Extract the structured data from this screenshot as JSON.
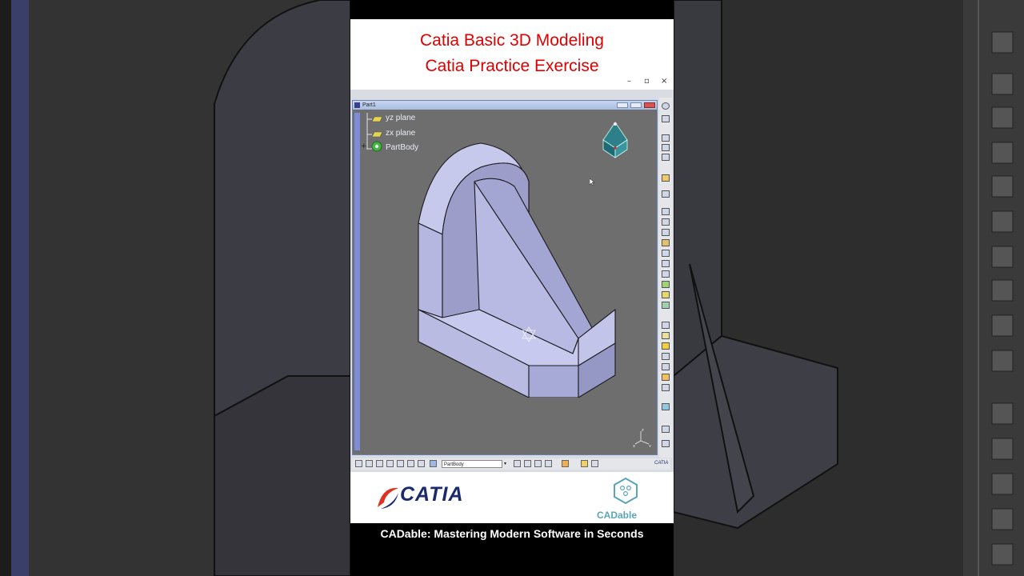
{
  "overlay": {
    "title_line1": "Catia Basic 3D Modeling",
    "title_line2": "Catia Practice Exercise",
    "caption": "CADable: Mastering Modern Software in Seconds"
  },
  "window_controls": {
    "minimize": "–",
    "restore": "▫",
    "close": "×"
  },
  "viewer": {
    "title": "Part1",
    "tree": [
      {
        "label": "yz plane",
        "icon": "plane-icon"
      },
      {
        "label": "zx plane",
        "icon": "plane-icon"
      },
      {
        "label": "PartBody",
        "icon": "partbody-gear-icon"
      }
    ],
    "axis_labels": {
      "z": "z",
      "x": "x",
      "y": "y"
    }
  },
  "toolbar": {
    "body_select": "PartBody",
    "brand": "CATIA"
  },
  "logos": {
    "catia": "CATIA",
    "cadable": "CADable"
  },
  "colors": {
    "title_red": "#e00000",
    "viewport_grey": "#6e6e6e",
    "part_face_light": "#c6c8ec",
    "part_face_mid": "#a7a9d6",
    "cadable_teal": "#5aa5b8",
    "catia_navy": "#1a2a6c"
  }
}
